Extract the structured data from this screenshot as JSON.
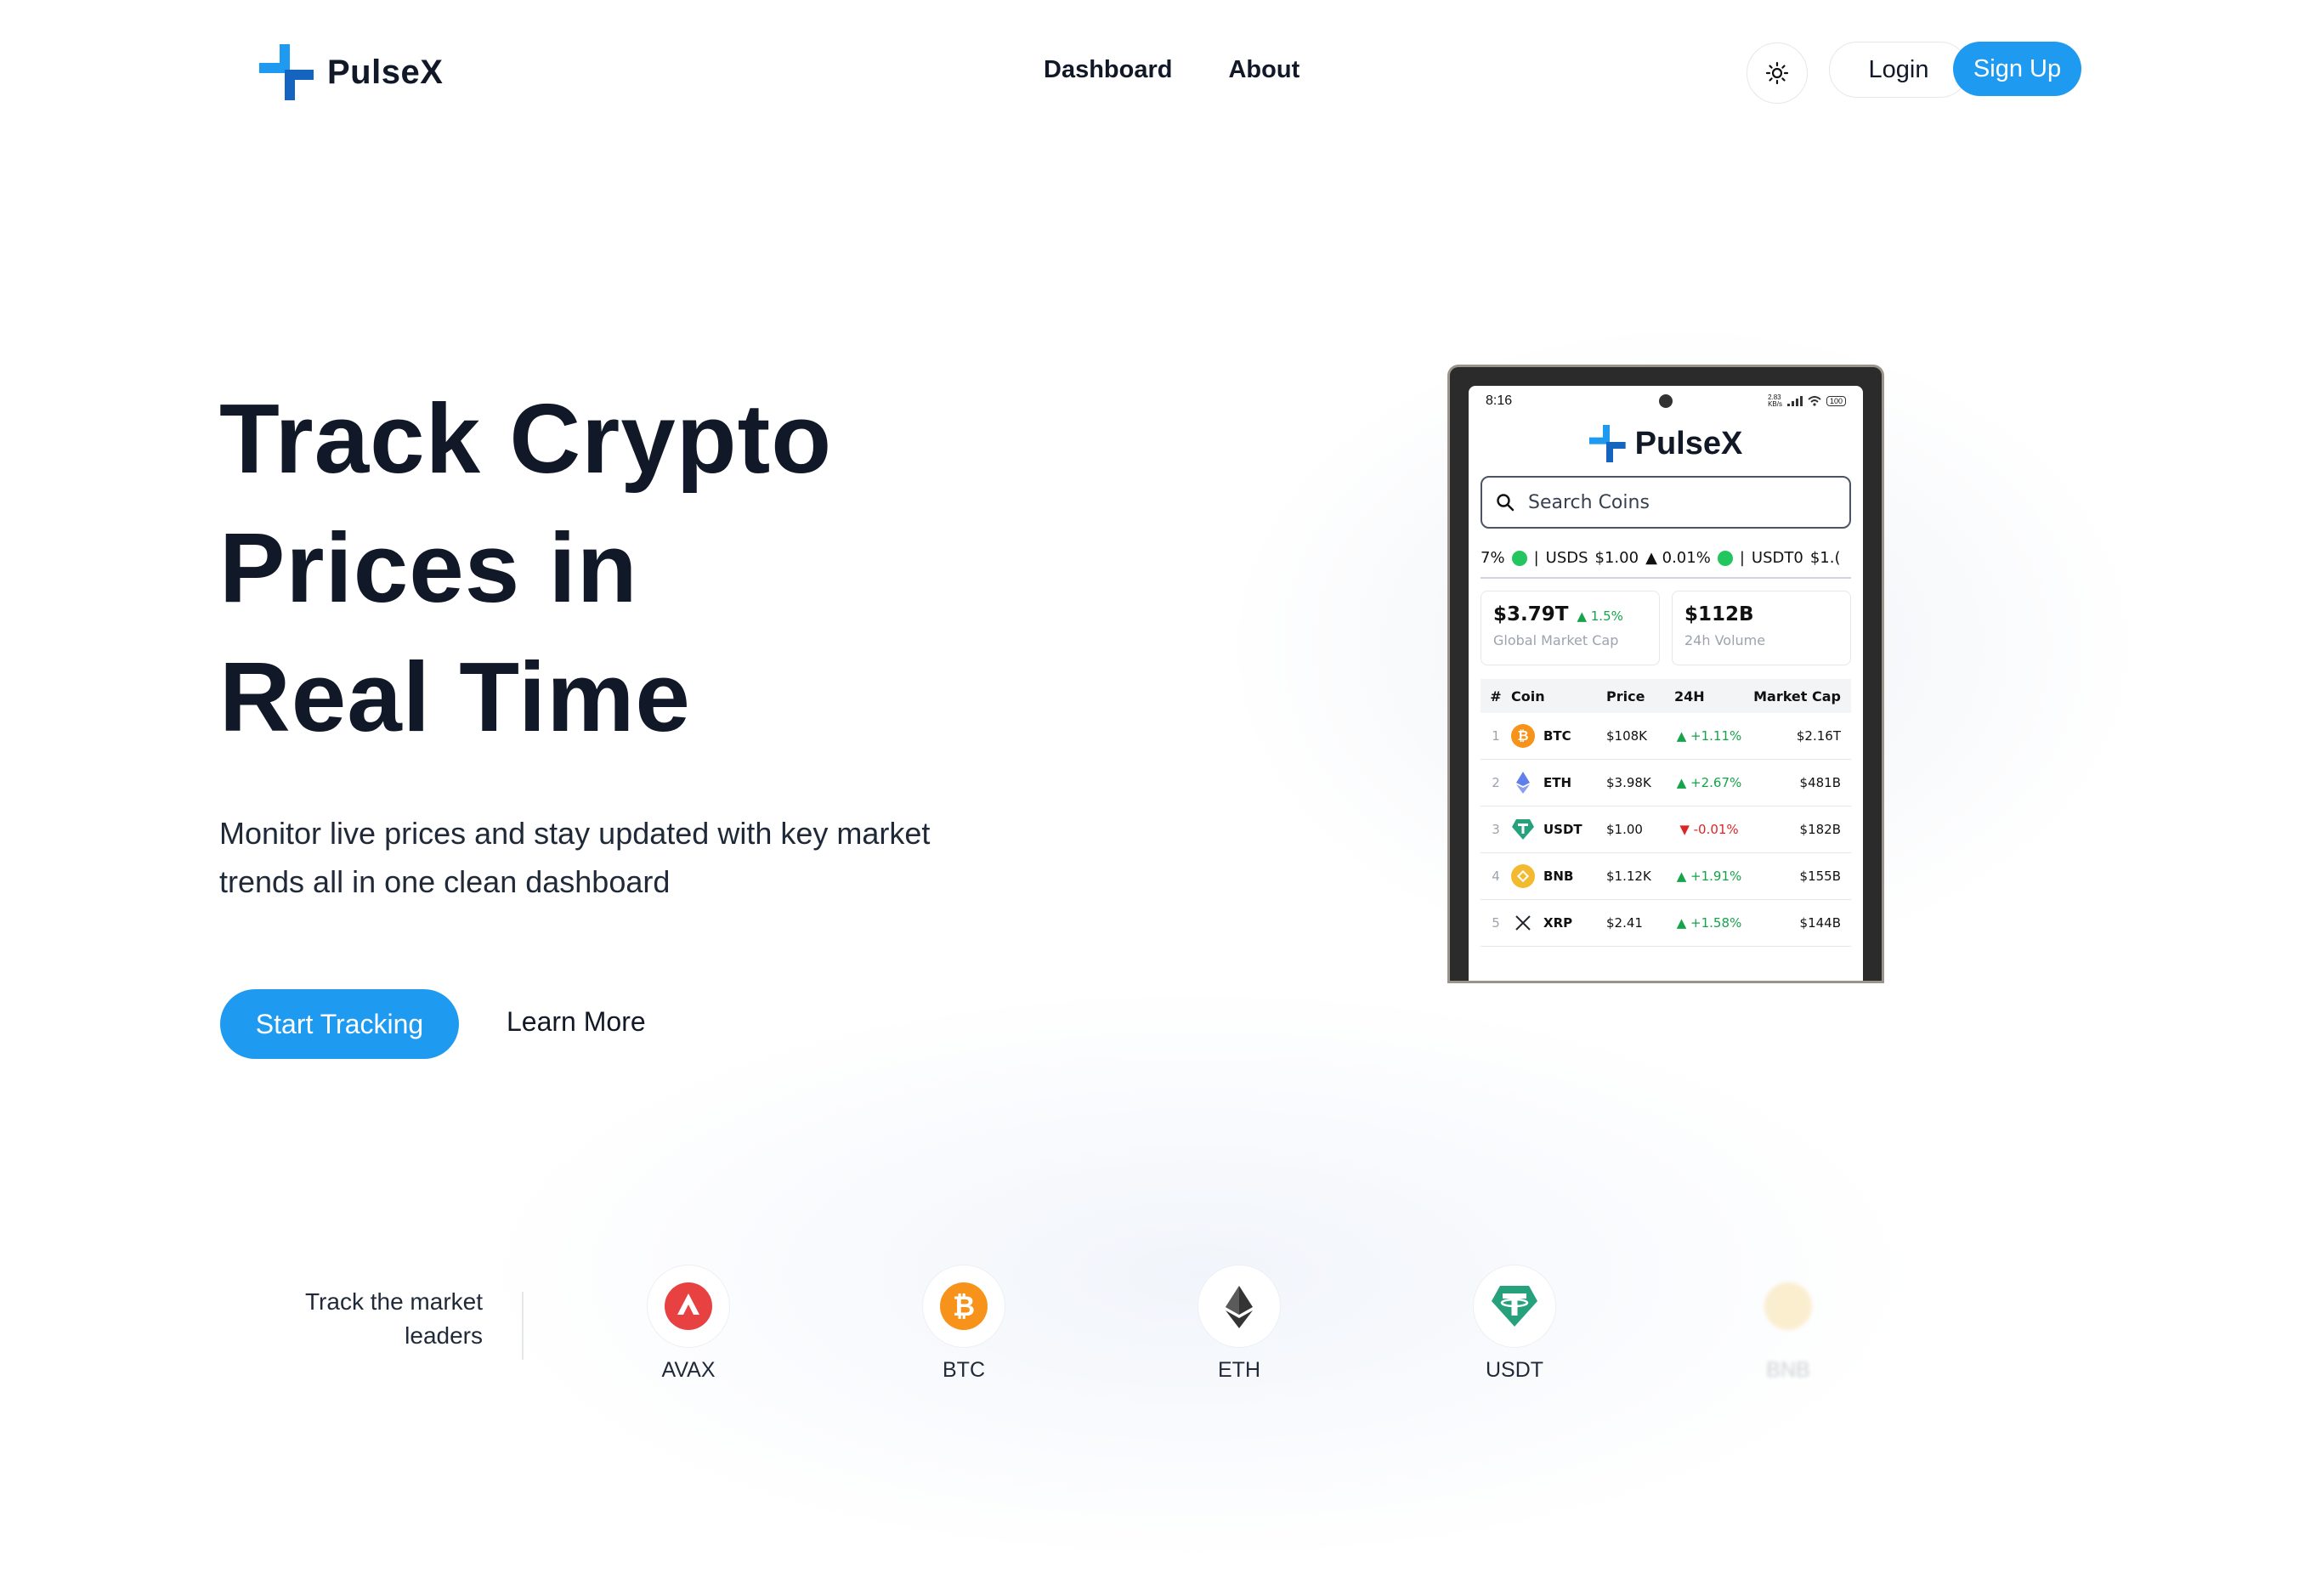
{
  "header": {
    "brand": "PulseX",
    "nav": [
      "Dashboard",
      "About"
    ],
    "login_label": "Login",
    "signup_label": "Sign Up",
    "theme_icon": "sun-icon"
  },
  "hero": {
    "title_lines": [
      "Track Crypto",
      "Prices in",
      "Real Time"
    ],
    "subtitle": "Monitor live prices and stay updated with key market trends all in one clean dashboard",
    "primary_cta": "Start Tracking",
    "secondary_cta": "Learn More"
  },
  "phone": {
    "time": "8:16",
    "status_text": "2.83\nKB/s",
    "battery": "100",
    "brand": "PulseX",
    "search_placeholder": "Search Coins",
    "ticker": {
      "lead_pct": "7%",
      "sep1": "|",
      "usds_label": "USDS",
      "usds_price": "$1.00",
      "usds_change": "▲ 0.01%",
      "sep2": "|",
      "usdt0_label": "USDT0",
      "usdt0_price": "$1.("
    },
    "stats": [
      {
        "value": "$3.79T",
        "change": "▲ 1.5%",
        "label": "Global Market Cap"
      },
      {
        "value": "$112B",
        "change": "",
        "label": "24h Volume"
      }
    ],
    "table": {
      "headers": [
        "#",
        "Coin",
        "Price",
        "24H",
        "Market Cap"
      ],
      "rows": [
        {
          "rank": "1",
          "coin": "BTC",
          "price": "$108K",
          "change": "▲ +1.11%",
          "cap": "$2.16T",
          "dir": "up",
          "color": "#f7931a"
        },
        {
          "rank": "2",
          "coin": "ETH",
          "price": "$3.98K",
          "change": "▲ +2.67%",
          "cap": "$481B",
          "dir": "up",
          "color": "#627eea"
        },
        {
          "rank": "3",
          "coin": "USDT",
          "price": "$1.00",
          "change": "▼ -0.01%",
          "cap": "$182B",
          "dir": "down",
          "color": "#26a17b"
        },
        {
          "rank": "4",
          "coin": "BNB",
          "price": "$1.12K",
          "change": "▲ +1.91%",
          "cap": "$155B",
          "dir": "up",
          "color": "#f3ba2f"
        },
        {
          "rank": "5",
          "coin": "XRP",
          "price": "$2.41",
          "change": "▲ +1.58%",
          "cap": "$144B",
          "dir": "up",
          "color": "#23292f"
        }
      ]
    }
  },
  "leaders": {
    "label": "Track the market leaders",
    "coins": [
      {
        "name": "AVAX",
        "color": "#e84142"
      },
      {
        "name": "BTC",
        "color": "#f7931a"
      },
      {
        "name": "ETH",
        "color": "#343434"
      },
      {
        "name": "USDT",
        "color": "#26a17b"
      },
      {
        "name": "BNB",
        "color": "#f3ba2f"
      }
    ]
  },
  "colors": {
    "accent": "#1e9bf0",
    "text": "#111827",
    "positive": "#16a34a",
    "negative": "#dc2626"
  }
}
